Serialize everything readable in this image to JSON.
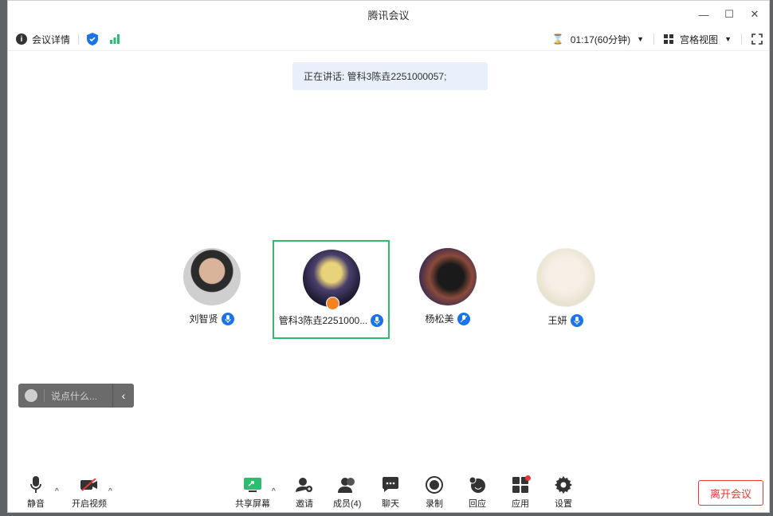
{
  "window": {
    "title": "腾讯会议"
  },
  "infobar": {
    "meeting_details": "会议详情",
    "timer": "01:17(60分钟)",
    "view_mode": "宫格视图"
  },
  "speaking": "正在讲话: 管科3陈垚2251000057;",
  "participants": [
    {
      "name": "刘智贤"
    },
    {
      "name": "管科3陈垚2251000..."
    },
    {
      "name": "杨松美"
    },
    {
      "name": "王妍"
    }
  ],
  "chat": {
    "placeholder": "说点什么..."
  },
  "toolbar": {
    "mute": "静音",
    "video": "开启视频",
    "share": "共享屏幕",
    "invite": "邀请",
    "members": "成员(4)",
    "chat": "聊天",
    "record": "录制",
    "react": "回应",
    "apps": "应用",
    "settings": "设置",
    "leave": "离开会议"
  },
  "colors": {
    "accent": "#1a73e8",
    "speaking_border": "#2dbd6e",
    "leave": "#e53935"
  }
}
